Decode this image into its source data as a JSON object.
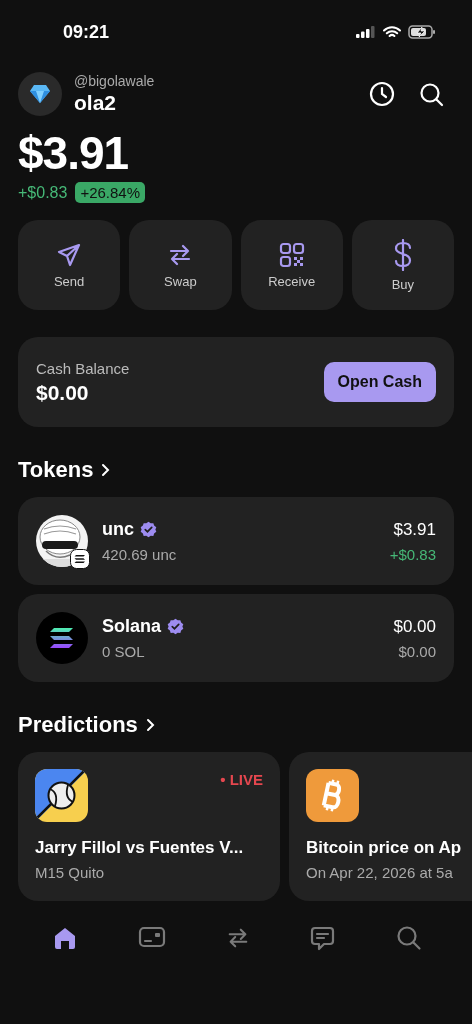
{
  "status_bar": {
    "time": "09:21"
  },
  "profile": {
    "handle": "@bigolawale",
    "name": "ola2"
  },
  "balance": {
    "amount": "$3.91",
    "change": "+$0.83",
    "percent": "+26.84%"
  },
  "actions": [
    {
      "kind": "send",
      "label": "Send"
    },
    {
      "kind": "swap",
      "label": "Swap"
    },
    {
      "kind": "receive",
      "label": "Receive"
    },
    {
      "kind": "buy",
      "label": "Buy"
    }
  ],
  "cash": {
    "label": "Cash Balance",
    "amount": "$0.00",
    "button": "Open Cash"
  },
  "tokens": {
    "title": "Tokens",
    "items": [
      {
        "kind": "picture",
        "name": "unc",
        "verified": true,
        "amount": "420.69 unc",
        "value": "$3.91",
        "change": "+$0.83",
        "positive": true
      },
      {
        "kind": "solana",
        "name": "Solana",
        "verified": true,
        "amount": "0 SOL",
        "value": "$0.00",
        "change": "$0.00",
        "positive": false
      }
    ]
  },
  "predictions": {
    "title": "Predictions",
    "items": [
      {
        "kind": "tennis",
        "live": true,
        "live_label": "• LIVE",
        "title": "Jarry Fillol vs Fuentes V...",
        "subtitle": "M15 Quito"
      },
      {
        "kind": "bitcoin",
        "live": false,
        "title": "Bitcoin price on Ap",
        "subtitle": "On Apr 22, 2026 at 5a"
      }
    ]
  },
  "tab_bar": [
    {
      "kind": "home",
      "selected": true
    },
    {
      "kind": "card",
      "selected": false
    },
    {
      "kind": "swap",
      "selected": false
    },
    {
      "kind": "chat",
      "selected": false
    },
    {
      "kind": "search",
      "selected": false
    }
  ]
}
